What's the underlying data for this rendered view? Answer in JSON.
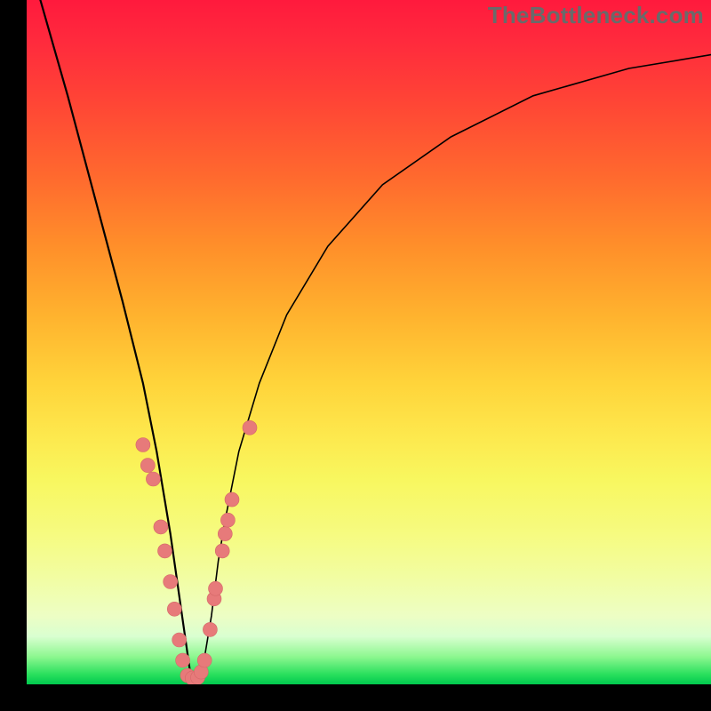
{
  "watermark": "TheBottleneck.com",
  "colors": {
    "frame": "#000000",
    "curve": "#000000",
    "marker_fill": "#e77a7a",
    "marker_stroke": "#d46868",
    "gradient_top": "#ff1a3d",
    "gradient_bottom": "#00c94e"
  },
  "chart_data": {
    "type": "line",
    "title": "",
    "xlabel": "",
    "ylabel": "",
    "xlim": [
      0,
      100
    ],
    "ylim": [
      0,
      100
    ],
    "notes": "V-shaped bottleneck curve over vertical rainbow gradient (red=high bottleneck, green=low). Minimum near x≈24. Scatter markers cluster along the curve in the low region (y < ~35). X/Y axes are unlabeled; values are estimated from pixel positions on a 0–100 normalized scale.",
    "series": [
      {
        "name": "bottleneck-curve",
        "x": [
          2,
          6,
          10,
          14,
          17,
          19,
          21,
          23,
          24,
          25,
          26,
          27,
          28,
          29,
          31,
          34,
          38,
          44,
          52,
          62,
          74,
          88,
          100
        ],
        "y": [
          100,
          86,
          71,
          56,
          44,
          34,
          22,
          8,
          1,
          1,
          4,
          10,
          18,
          24,
          34,
          44,
          54,
          64,
          73,
          80,
          86,
          90,
          92
        ]
      }
    ],
    "markers": {
      "name": "sample-points",
      "points": [
        {
          "x": 17.0,
          "y": 35.0
        },
        {
          "x": 17.7,
          "y": 32.0
        },
        {
          "x": 18.5,
          "y": 30.0
        },
        {
          "x": 19.6,
          "y": 23.0
        },
        {
          "x": 20.2,
          "y": 19.5
        },
        {
          "x": 21.0,
          "y": 15.0
        },
        {
          "x": 21.6,
          "y": 11.0
        },
        {
          "x": 22.3,
          "y": 6.5
        },
        {
          "x": 22.8,
          "y": 3.5
        },
        {
          "x": 23.5,
          "y": 1.3
        },
        {
          "x": 24.2,
          "y": 0.9
        },
        {
          "x": 25.0,
          "y": 1.0
        },
        {
          "x": 25.5,
          "y": 1.8
        },
        {
          "x": 26.0,
          "y": 3.5
        },
        {
          "x": 26.8,
          "y": 8.0
        },
        {
          "x": 27.4,
          "y": 12.5
        },
        {
          "x": 27.6,
          "y": 14.0
        },
        {
          "x": 28.6,
          "y": 19.5
        },
        {
          "x": 29.0,
          "y": 22.0
        },
        {
          "x": 29.4,
          "y": 24.0
        },
        {
          "x": 30.0,
          "y": 27.0
        },
        {
          "x": 32.6,
          "y": 37.5
        }
      ]
    }
  }
}
